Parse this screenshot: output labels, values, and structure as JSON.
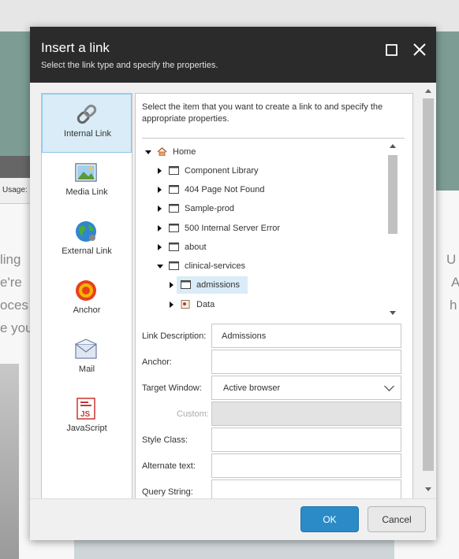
{
  "background": {
    "usage_label": "Usage:",
    "left_text_lines": [
      "ling",
      "e're",
      "oces",
      "e you"
    ],
    "right_text_lines": [
      "U",
      "A",
      "h"
    ]
  },
  "dialog": {
    "title": "Insert a link",
    "subtitle": "Select the link type and specify the properties.",
    "maximize_icon": "maximize-icon",
    "close_icon": "close-icon"
  },
  "link_types": [
    {
      "label": "Internal Link",
      "icon": "chain-link-icon",
      "active": true
    },
    {
      "label": "Media Link",
      "icon": "picture-icon",
      "active": false
    },
    {
      "label": "External Link",
      "icon": "globe-icon",
      "active": false
    },
    {
      "label": "Anchor",
      "icon": "target-icon",
      "active": false
    },
    {
      "label": "Mail",
      "icon": "envelope-icon",
      "active": false
    },
    {
      "label": "JavaScript",
      "icon": "javascript-file-icon",
      "active": false
    }
  ],
  "instructions": "Select the item that you want to create a link to and specify the appropriate properties.",
  "tree": [
    {
      "label": "Home",
      "level": 0,
      "expanded": true,
      "icon": "home-icon",
      "selected": false
    },
    {
      "label": "Component Library",
      "level": 1,
      "expanded": false,
      "icon": "page-icon",
      "selected": false
    },
    {
      "label": "404 Page Not Found",
      "level": 1,
      "expanded": false,
      "icon": "page-icon",
      "selected": false
    },
    {
      "label": "Sample-prod",
      "level": 1,
      "expanded": false,
      "icon": "page-icon",
      "selected": false
    },
    {
      "label": "500 Internal Server Error",
      "level": 1,
      "expanded": false,
      "icon": "page-icon",
      "selected": false
    },
    {
      "label": "about",
      "level": 1,
      "expanded": false,
      "icon": "page-icon",
      "selected": false
    },
    {
      "label": "clinical-services",
      "level": 1,
      "expanded": true,
      "icon": "page-icon",
      "selected": false
    },
    {
      "label": "admissions",
      "level": 2,
      "expanded": false,
      "icon": "page-icon",
      "selected": true
    },
    {
      "label": "Data",
      "level": 2,
      "expanded": false,
      "icon": "data-folder-icon",
      "selected": false
    }
  ],
  "fields": {
    "link_description": {
      "label": "Link Description:",
      "value": "Admissions"
    },
    "anchor": {
      "label": "Anchor:",
      "value": ""
    },
    "target_window": {
      "label": "Target Window:",
      "value": "Active browser"
    },
    "custom": {
      "label": "Custom:",
      "value": ""
    },
    "style_class": {
      "label": "Style Class:",
      "value": ""
    },
    "alternate_text": {
      "label": "Alternate text:",
      "value": ""
    },
    "query_string": {
      "label": "Query String:",
      "value": ""
    }
  },
  "buttons": {
    "ok": "OK",
    "cancel": "Cancel"
  },
  "colors": {
    "header_bg": "#2b2b2b",
    "accent": "#2b8bc6",
    "selection_bg": "#d9ecf7",
    "background_band": "#7d9c93"
  }
}
